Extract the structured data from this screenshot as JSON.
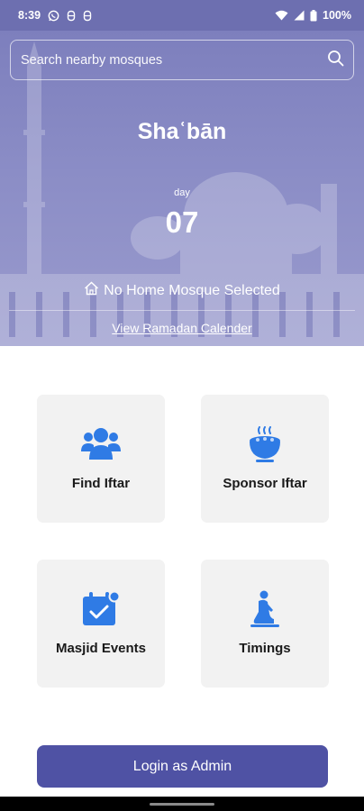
{
  "status_bar": {
    "time": "8:39",
    "battery": "100%",
    "icons": [
      "whatsapp-icon",
      "notification-icon",
      "notification-icon",
      "wifi-icon",
      "signal-icon",
      "battery-icon"
    ]
  },
  "search": {
    "placeholder": "Search nearby mosques"
  },
  "hero": {
    "month": "Shaʿbān",
    "day_label": "day",
    "day_number": "07",
    "home_mosque": "No Home Mosque Selected",
    "calendar_link": "View Ramadan Calender"
  },
  "tiles": [
    {
      "label": "Find Iftar",
      "icon": "users-icon"
    },
    {
      "label": "Sponsor Iftar",
      "icon": "food-bowl-icon"
    },
    {
      "label": "Masjid Events",
      "icon": "calendar-check-icon"
    },
    {
      "label": "Timings",
      "icon": "prayer-icon"
    }
  ],
  "login_button": "Login as Admin",
  "colors": {
    "primary": "#4f52a4",
    "hero_overlay": "#8587c3",
    "icon_blue": "#2f7be5",
    "tile_bg": "#f2f2f2"
  }
}
